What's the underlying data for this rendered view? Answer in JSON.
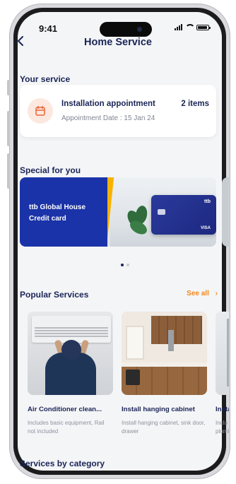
{
  "status_bar": {
    "time": "9:41"
  },
  "header": {
    "back_icon": "chevron-left",
    "title": "Home Service"
  },
  "your_service": {
    "heading": "Your service",
    "appointment": {
      "icon": "calendar-icon",
      "title": "Installation appointment",
      "count": "2 items",
      "date": "Appointment Date : 15 Jan 24"
    }
  },
  "special": {
    "heading": "Special for you",
    "banner_text": "ttb Global House Credit card",
    "card_brand": "ttb",
    "card_network": "VISA",
    "pagination": {
      "count": 2,
      "active": 1
    }
  },
  "popular": {
    "heading": "Popular Services",
    "see_all": "See all",
    "items": [
      {
        "name": "Air Conditioner clean...",
        "desc": "Includes basic equipment, Rail not included"
      },
      {
        "name": "Install hanging cabinet",
        "desc": "Install hanging cabinet, sink door, drawer"
      },
      {
        "name": "Insta",
        "desc": "Inclu plumt"
      }
    ]
  },
  "category": {
    "heading": "Services by category"
  },
  "colors": {
    "primary": "#1b2557",
    "accent": "#f08a1c",
    "banner_blue": "#1a33a8"
  }
}
